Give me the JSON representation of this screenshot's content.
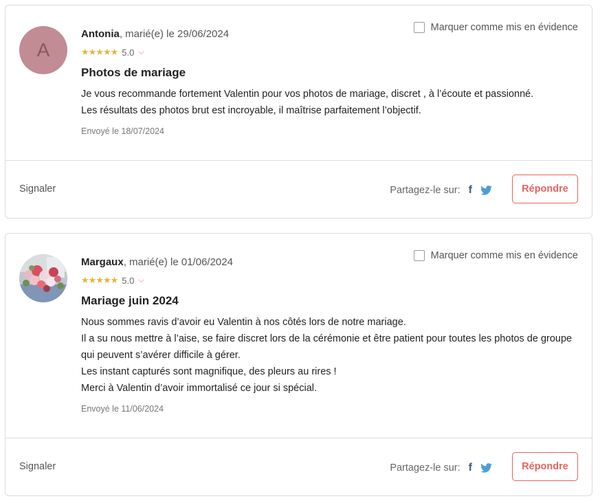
{
  "reviews": [
    {
      "avatar_letter": "A",
      "author": "Antonia",
      "meta": ", marié(e) le 29/06/2024",
      "stars": "★★★★★",
      "rating": "5.0",
      "title": "Photos de mariage",
      "body": [
        "Je vous recommande fortement Valentin pour vos photos de mariage, discret , à l’écoute et passionné.",
        "Les résultats des photos brut est incroyable, il maîtrise parfaitement l’objectif."
      ],
      "sent": "Envoyé le 18/07/2024",
      "feature_label": "Marquer comme mis en évidence",
      "report_label": "Signaler",
      "share_label": "Partagez-le sur:",
      "reply_label": "Répondre"
    },
    {
      "avatar_letter": "",
      "author": "Margaux",
      "meta": ", marié(e) le 01/06/2024",
      "stars": "★★★★★",
      "rating": "5.0",
      "title": "Mariage juin 2024",
      "body": [
        "Nous sommes ravis d’avoir eu Valentin à nos côtés lors de notre mariage.",
        "Il a su nous mettre à l’aise, se faire discret lors de la cérémonie et être patient pour toutes les photos de groupe qui peuvent s’avérer difficile à gérer.",
        "Les instant capturés sont magnifique, des pleurs au rires !",
        "Merci à Valentin d’avoir immortalisé ce jour si spécial."
      ],
      "sent": "Envoyé le 11/06/2024",
      "feature_label": "Marquer comme mis en évidence",
      "report_label": "Signaler",
      "share_label": "Partagez-le sur:",
      "reply_label": "Répondre"
    }
  ],
  "icons": {
    "facebook": "f",
    "chevron": "⌵"
  },
  "colors": {
    "accent": "#e8625e",
    "stars": "#e6b53a",
    "facebook": "#3b5998",
    "twitter": "#4a9fd8"
  }
}
